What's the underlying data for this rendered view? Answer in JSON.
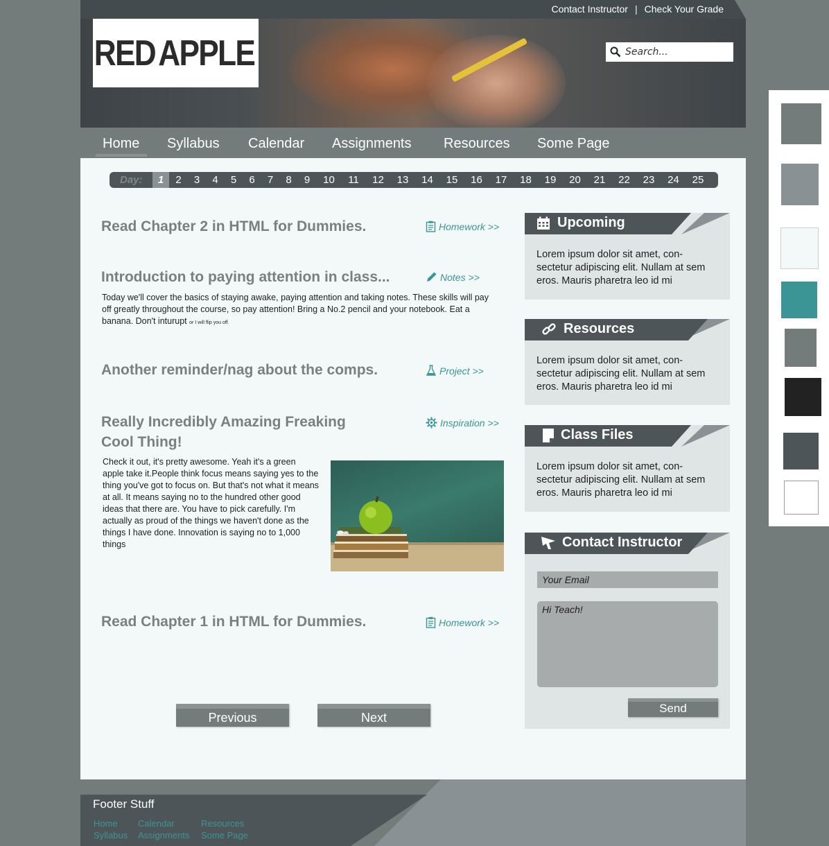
{
  "header": {
    "top_links": [
      "Contact Instructor",
      "Check Your Grade"
    ],
    "search_placeholder": "Search...",
    "logo_left": "RED",
    "logo_right": "APPLE"
  },
  "nav": {
    "items": [
      "Home",
      "Syllabus",
      "Calendar",
      "Assignments",
      "Resources",
      "Some Page"
    ],
    "active": "Home"
  },
  "days": {
    "label": "Day:",
    "current": "1",
    "list": [
      "1",
      "2",
      "3",
      "4",
      "5",
      "6",
      "7",
      "8",
      "9",
      "10",
      "11",
      "12",
      "13",
      "14",
      "15",
      "16",
      "17",
      "18",
      "19",
      "20",
      "21",
      "22",
      "23",
      "24",
      "25"
    ]
  },
  "posts": [
    {
      "title": "Read Chapter 2 in HTML for Dummies.",
      "link": "Homework >>",
      "icon": "clipboard-icon"
    },
    {
      "title": "Introduction to paying attention in class...",
      "link": "Notes >>",
      "icon": "pencil-icon",
      "body": "Today we'll cover the basics of staying awake, paying attention and taking notes. These skills will pay off greatly throughout the course, so pay attention! Bring a No.2 pencil and your notebook. Eat a banana. Don't inturupt",
      "small": "or I will flip you off."
    },
    {
      "title": "Another reminder/nag about the comps.",
      "link": "Project >>",
      "icon": "flask-icon"
    },
    {
      "title_line1": "Really Incredibly Amazing Freaking",
      "title_line2": "Cool Thing!",
      "link": "Inspiration >>",
      "icon": "gear-icon",
      "body": "Check it out, it's pretty awesome. Yeah it's a green apple take it.People think focus means saying yes to the thing you've got to focus on. But that's not what it means at all. It means saying no to the hundred other good ideas that there are. You have to pick carefully. I'm actually as proud of the things we haven't done as the things I have done. Innovation is saying no to 1,000 things"
    },
    {
      "title": "Read Chapter 1 in HTML for Dummies.",
      "link": "Homework >>",
      "icon": "clipboard-icon"
    }
  ],
  "pager": {
    "previous": "Previous",
    "next": "Next"
  },
  "sidebar": {
    "upcoming": {
      "title": "Upcoming",
      "body": "Lorem ipsum dolor sit amet, con-sectetur adipiscing elit. Nullam at sem eros. Mauris pharetra leo id mi"
    },
    "resources": {
      "title": "Resources",
      "body": "Lorem ipsum dolor sit amet, con-sectetur adipiscing elit. Nullam at sem eros. Mauris pharetra leo id mi"
    },
    "class_files": {
      "title": "Class Files",
      "body": "Lorem ipsum dolor sit amet, con-sectetur adipiscing elit. Nullam at sem eros. Mauris pharetra leo id mi"
    },
    "contact": {
      "title": "Contact Instructor",
      "email_placeholder": "Your Email",
      "message_placeholder": "Hi Teach!",
      "send": "Send"
    }
  },
  "footer": {
    "title": "Footer Stuff",
    "links": [
      "Home",
      "Calendar",
      "Resources",
      "Syllabus",
      "Assignments",
      "Some Page"
    ]
  },
  "colors": {
    "background": "#737b7b",
    "dark": "#4d5558",
    "teal": "#3c9595",
    "panel": "#f3f8f8",
    "swatches": [
      "#737b7b",
      "#8a9194",
      "#f3f8f8",
      "#3c9595",
      "#737b7b",
      "#222222",
      "#4d5558",
      "#ffffff"
    ]
  }
}
